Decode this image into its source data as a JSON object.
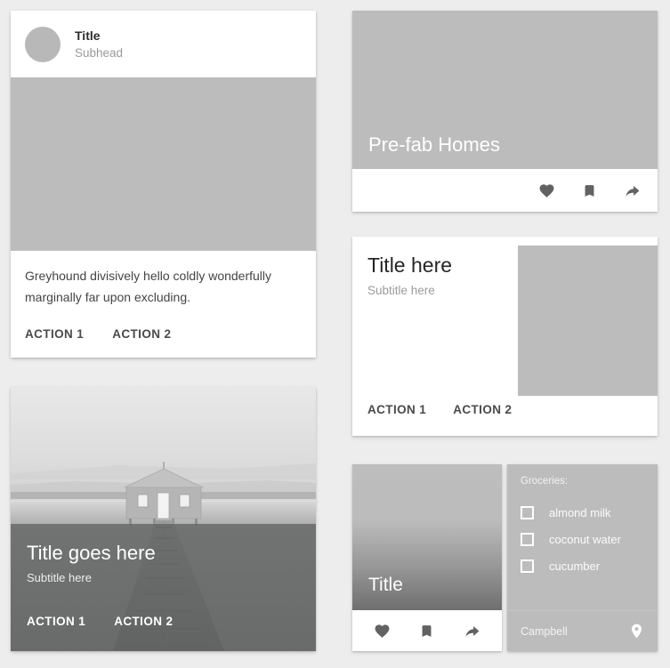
{
  "page": {
    "background_color": "#ededed",
    "placeholder_gray": "#bcbcbc",
    "icon_gray": "#626262"
  },
  "cards": {
    "card_basic": {
      "title": "Title",
      "subhead": "Subhead",
      "body": "Greyhound divisively hello coldly wonderfully marginally far upon excluding.",
      "action1": "ACTION 1",
      "action2": "ACTION 2",
      "avatar_icon": "avatar-circle"
    },
    "card_photo": {
      "title": "Title goes here",
      "subtitle": "Subtitle here",
      "action1": "ACTION 1",
      "action2": "ACTION 2",
      "photo_description": "boathouse-on-water-with-jetty"
    },
    "card_prefab": {
      "title": "Pre-fab Homes",
      "icons": [
        "heart-icon",
        "bookmark-icon",
        "share-icon"
      ]
    },
    "card_title_here": {
      "title": "Title here",
      "subtitle": "Subtitle here",
      "action1": "ACTION 1",
      "action2": "ACTION 2"
    },
    "card_gradient": {
      "title": "Title",
      "icons": [
        "heart-icon",
        "bookmark-icon",
        "share-icon"
      ]
    },
    "card_groceries": {
      "heading": "Groceries:",
      "items": [
        {
          "label": "almond milk",
          "checked": false
        },
        {
          "label": "coconut water",
          "checked": false
        },
        {
          "label": "cucumber",
          "checked": false
        }
      ],
      "place": "Campbell",
      "place_icon": "map-pin-icon"
    }
  }
}
